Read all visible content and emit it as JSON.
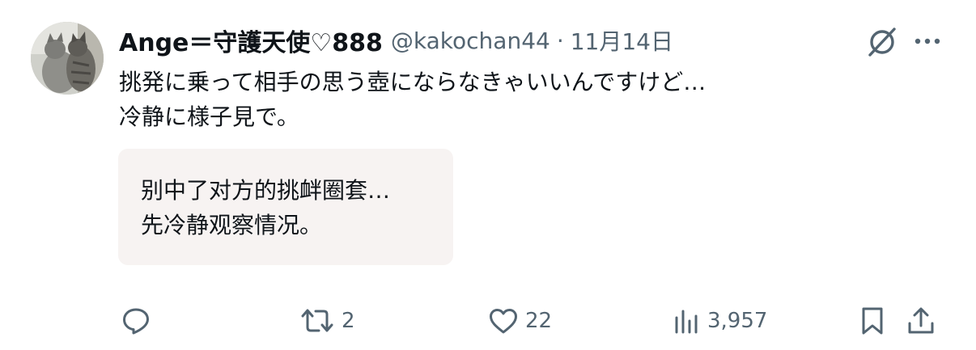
{
  "author": {
    "display_name": "Ange＝守護天使♡888",
    "handle": "@kakochan44",
    "separator": "·",
    "date": "11月14日"
  },
  "tweet": {
    "lines": [
      "挑発に乗って相手の思う壺にならなきゃいいんですけど…",
      "冷静に様子見で。"
    ]
  },
  "translation": {
    "lines": [
      "别中了对方的挑衅圈套…",
      "先冷静观察情况。"
    ]
  },
  "actions": {
    "reply_count": "",
    "retweet_count": "2",
    "like_count": "22",
    "view_count": "3,957"
  },
  "colors": {
    "text_primary": "#0f1419",
    "text_secondary": "#536471",
    "translation_bg": "#f7f3f2"
  },
  "icons": {
    "header": [
      "grok-icon",
      "more-icon"
    ],
    "actions": [
      "reply-icon",
      "retweet-icon",
      "like-icon",
      "views-icon",
      "bookmark-icon",
      "share-icon"
    ]
  }
}
